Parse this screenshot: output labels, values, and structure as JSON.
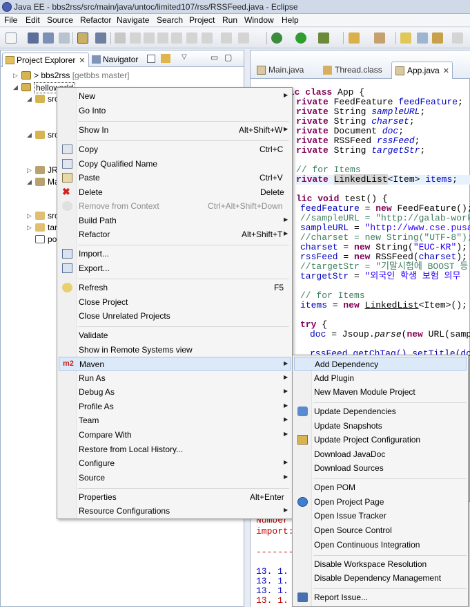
{
  "window": {
    "title": "Java EE - bbs2rss/src/main/java/untoc/limited107/rss/RSSFeed.java - Eclipse"
  },
  "menubar": [
    "File",
    "Edit",
    "Source",
    "Refactor",
    "Navigate",
    "Search",
    "Project",
    "Run",
    "Window",
    "Help"
  ],
  "explorer": {
    "tabs": [
      {
        "label": "Project Explorer",
        "active": true
      },
      {
        "label": "Navigator",
        "active": false
      }
    ],
    "tree": {
      "bbs2rss": "> bbs2rss",
      "bbs2rss_branch": "[getbbs master]",
      "helloworld": "helloworld",
      "partials": [
        "src",
        "src",
        "JR",
        "Ma",
        "src",
        "tar",
        "po"
      ]
    }
  },
  "editor": {
    "tabs": [
      "Main.java",
      "Thread.class",
      "App.java"
    ],
    "active_tab": "App.java",
    "code": {
      "l1_kw": "lic class",
      "l1_rest": " App {",
      "priv": "rivate",
      "l2_type": " FeedFeature ",
      "l2_var": "feedFeature",
      "l3_type": " String ",
      "l3_var": "sampleURL",
      "l4_type": " String ",
      "l4_var": "charset",
      "l5_type": " Document ",
      "l5_var": "doc",
      "l6_type": " RSSFeed ",
      "l6_var": "rssFeed",
      "l7_type": " String ",
      "l7_var": "targetStr",
      "semi": ";",
      "c1": "// for Items",
      "l8_type": "LinkedList",
      "l8_gen": "<Item> ",
      "l8_var": "items",
      "m_kw1": "lic",
      "m_kw2": "void",
      "m_name": " test() {",
      "s1_var": "feedFeature",
      "s1_op": " = ",
      "s1_new": "new",
      "s1_rest": " FeedFeature();",
      "s2": "//sampleURL = \"http://galab-work.",
      "s3_var": "sampleURL",
      "s3_op": " = ",
      "s3_str": "\"http://www.cse.pusan",
      "s4": "//charset = new String(\"UTF-8\");",
      "s5_var": "charset",
      "s5_op": " = ",
      "s5_new": "new",
      "s5_mid": " String(",
      "s5_str": "\"EUC-KR\"",
      "s5_end": ");",
      "s6_var": "rssFeed",
      "s6_op": " = ",
      "s6_new": "new",
      "s6_mid": " RSSFeed(",
      "s6_arg": "charset",
      "s6_end": ");",
      "s7": "//targetStr = \"기말시험에 BOOST 등",
      "s8_var": "targetStr",
      "s8_op": " = ",
      "s8_str": "\"외국인 학생 보험 의무",
      "c2": "// for Items",
      "s9_var": "items",
      "s9_op": " = ",
      "s9_new": "new",
      "s9_type": "LinkedList",
      "s9_end": "<Item>();",
      "try_kw": "try",
      "try_rest": " {",
      "s10_var": "doc",
      "s10_op": " = Jsoup.",
      "s10_m": "parse",
      "s10_mid": "(",
      "s10_new": "new",
      "s10_end": " URL(sampl",
      "s11": "rssFeed.getChTag().setTitle(doc"
    },
    "console": {
      "lines": [
        "Number",
        "import:",
        "-------",
        "13. 1.",
        "13. 1.",
        "13. 1.",
        "13. 1."
      ]
    }
  },
  "context_menu": {
    "items": [
      {
        "label": "New",
        "sub": true
      },
      {
        "label": "Go Into"
      },
      {
        "sep": true
      },
      {
        "label": "Show In",
        "shortcut": "Alt+Shift+W",
        "sub": true
      },
      {
        "sep": true
      },
      {
        "label": "Copy",
        "shortcut": "Ctrl+C",
        "icon": "copy-icon"
      },
      {
        "label": "Copy Qualified Name",
        "icon": "copy-qualified-icon"
      },
      {
        "label": "Paste",
        "shortcut": "Ctrl+V",
        "icon": "paste-icon"
      },
      {
        "label": "Delete",
        "shortcut": "Delete",
        "icon": "delete-icon"
      },
      {
        "label": "Remove from Context",
        "shortcut": "Ctrl+Alt+Shift+Down",
        "disabled": true,
        "icon": "remove-context-icon"
      },
      {
        "label": "Build Path",
        "sub": true
      },
      {
        "label": "Refactor",
        "shortcut": "Alt+Shift+T",
        "sub": true
      },
      {
        "sep": true
      },
      {
        "label": "Import...",
        "icon": "import-icon"
      },
      {
        "label": "Export...",
        "icon": "export-icon"
      },
      {
        "sep": true
      },
      {
        "label": "Refresh",
        "shortcut": "F5",
        "icon": "refresh-icon"
      },
      {
        "label": "Close Project"
      },
      {
        "label": "Close Unrelated Projects"
      },
      {
        "sep": true
      },
      {
        "label": "Validate"
      },
      {
        "label": "Show in Remote Systems view"
      },
      {
        "label": "Maven",
        "sub": true,
        "icon": "maven-m2-icon",
        "selected": true
      },
      {
        "label": "Run As",
        "sub": true
      },
      {
        "label": "Debug As",
        "sub": true
      },
      {
        "label": "Profile As",
        "sub": true
      },
      {
        "label": "Team",
        "sub": true
      },
      {
        "label": "Compare With",
        "sub": true
      },
      {
        "label": "Restore from Local History..."
      },
      {
        "label": "Configure",
        "sub": true
      },
      {
        "label": "Source",
        "sub": true
      },
      {
        "sep": true
      },
      {
        "label": "Properties",
        "shortcut": "Alt+Enter"
      },
      {
        "label": "Resource Configurations",
        "sub": true
      }
    ],
    "m2_badge": "m2"
  },
  "maven_menu": {
    "items": [
      {
        "label": "Add Dependency",
        "selected": true
      },
      {
        "label": "Add Plugin"
      },
      {
        "label": "New Maven Module Project"
      },
      {
        "sep": true
      },
      {
        "label": "Update Dependencies",
        "icon": "update-dependencies-icon"
      },
      {
        "label": "Update Snapshots"
      },
      {
        "label": "Update Project Configuration",
        "icon": "update-config-icon"
      },
      {
        "label": "Download JavaDoc"
      },
      {
        "label": "Download Sources"
      },
      {
        "sep": true
      },
      {
        "label": "Open POM"
      },
      {
        "label": "Open Project Page",
        "icon": "globe-icon"
      },
      {
        "label": "Open Issue Tracker"
      },
      {
        "label": "Open Source Control"
      },
      {
        "label": "Open Continuous Integration"
      },
      {
        "sep": true
      },
      {
        "label": "Disable Workspace Resolution"
      },
      {
        "label": "Disable Dependency Management"
      },
      {
        "sep": true
      },
      {
        "label": "Report Issue...",
        "icon": "report-issue-icon"
      }
    ]
  },
  "colors": {
    "menu_highlight": "#dbe9f9",
    "keyword": "#7f0055",
    "field": "#0000c0",
    "string": "#2a00ff",
    "comment": "#3f7f5f"
  }
}
